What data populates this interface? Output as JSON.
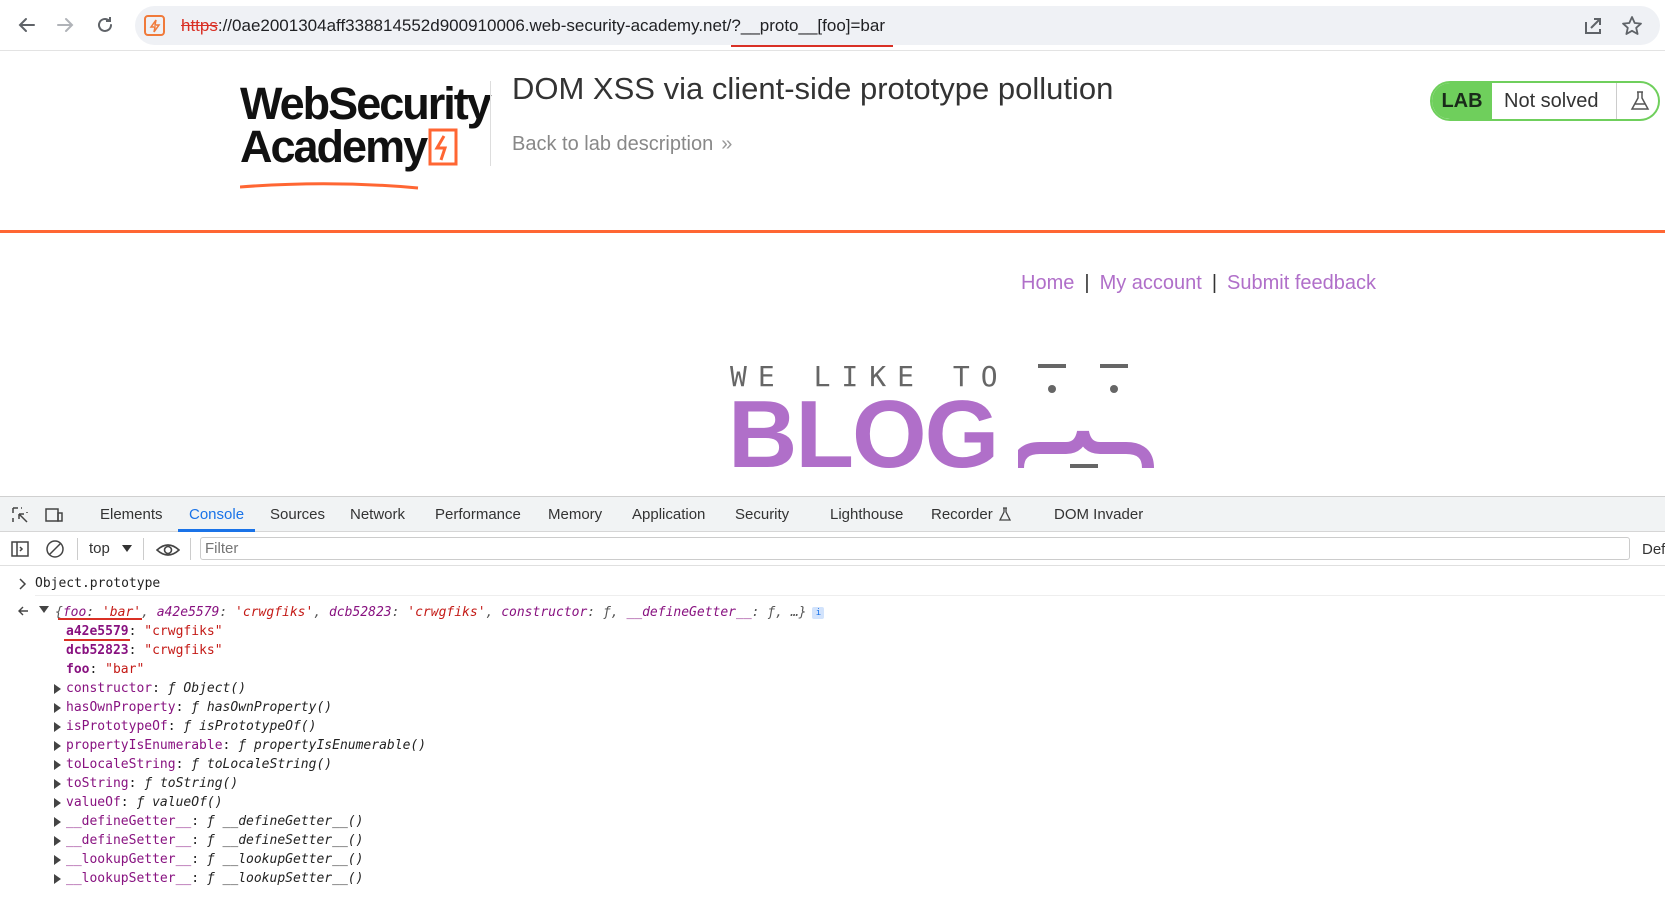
{
  "browser": {
    "url_scheme": "https",
    "url_rest": "://0ae2001304aff338814552d900910006.web-security-academy.net/?__proto__[foo]=bar"
  },
  "lab": {
    "logo_line1": "WebSecurity",
    "logo_line2": "Academy",
    "title": "DOM XSS via client-side prototype pollution",
    "back_link": "Back to lab description",
    "back_chevron": "»",
    "badge_label": "LAB",
    "badge_status": "Not solved"
  },
  "blog": {
    "nav": [
      {
        "label": "Home"
      },
      {
        "label": "My account"
      },
      {
        "label": "Submit feedback"
      }
    ],
    "nav_separator": "|",
    "logo_small": "WE LIKE TO",
    "logo_big": "BLOG"
  },
  "devtools": {
    "tabs": [
      "Elements",
      "Console",
      "Sources",
      "Network",
      "Performance",
      "Memory",
      "Application",
      "Security",
      "Lighthouse",
      "Recorder",
      "DOM Invader"
    ],
    "active_tab": "Console",
    "context": "top",
    "filter_placeholder": "Filter",
    "default_levels": "Def",
    "console": {
      "command": "Object.prototype",
      "summary": {
        "open": "{",
        "k1": "foo",
        "v1": "'bar'",
        "k2": "a42e5579",
        "v2": "'crwgfiks'",
        "k3": "dcb52823",
        "v3": "'crwgfiks'",
        "k4": "constructor",
        "v4": "ƒ",
        "k5": "__defineGetter__",
        "v5": "ƒ",
        "tail": "…}",
        "info": "i"
      },
      "own_props": [
        {
          "name": "a42e5579",
          "value": "\"crwgfiks\""
        },
        {
          "name": "dcb52823",
          "value": "\"crwgfiks\""
        },
        {
          "name": "foo",
          "value": "\"bar\""
        }
      ],
      "proto_props": [
        {
          "name": "constructor",
          "value": "Object()"
        },
        {
          "name": "hasOwnProperty",
          "value": "hasOwnProperty()"
        },
        {
          "name": "isPrototypeOf",
          "value": "isPrototypeOf()"
        },
        {
          "name": "propertyIsEnumerable",
          "value": "propertyIsEnumerable()"
        },
        {
          "name": "toLocaleString",
          "value": "toLocaleString()"
        },
        {
          "name": "toString",
          "value": "toString()"
        },
        {
          "name": "valueOf",
          "value": "valueOf()"
        },
        {
          "name": "__defineGetter__",
          "value": "__defineGetter__()"
        },
        {
          "name": "__defineSetter__",
          "value": "__defineSetter__()"
        },
        {
          "name": "__lookupGetter__",
          "value": "__lookupGetter__()"
        },
        {
          "name": "__lookupSetter__",
          "value": "__lookupSetter__()"
        }
      ],
      "fn_glyph": "ƒ"
    }
  },
  "colors": {
    "accent_orange": "#ff6633",
    "blog_purple": "#b06fc9",
    "lab_green": "#6fcf5c",
    "devtools_blue": "#1a73e8"
  }
}
